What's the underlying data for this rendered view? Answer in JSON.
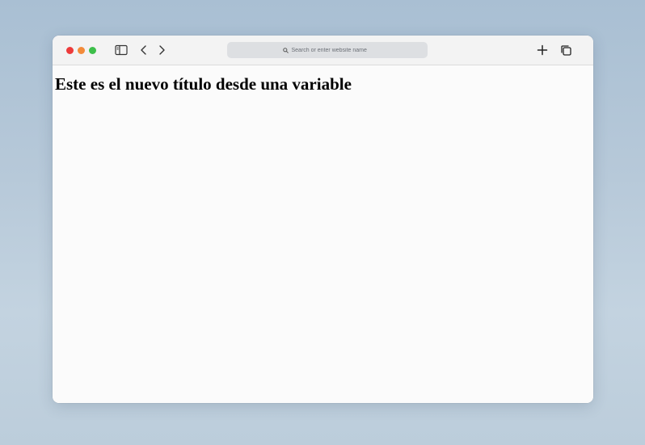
{
  "window": {
    "controls": {
      "close_color": "#ed3b3b",
      "minimize_color": "#f38b3a",
      "zoom_color": "#3dbf4a"
    }
  },
  "toolbar": {
    "icons": {
      "sidebar": "sidebar-icon",
      "back": "chevron-left-icon",
      "forward": "chevron-right-icon",
      "new_tab": "plus-icon",
      "tab_overview": "tabs-icon",
      "search": "search-icon"
    },
    "address_bar": {
      "placeholder": "Search or enter website name",
      "value": ""
    }
  },
  "page": {
    "title": "Este es el nuevo título desde una variable"
  }
}
